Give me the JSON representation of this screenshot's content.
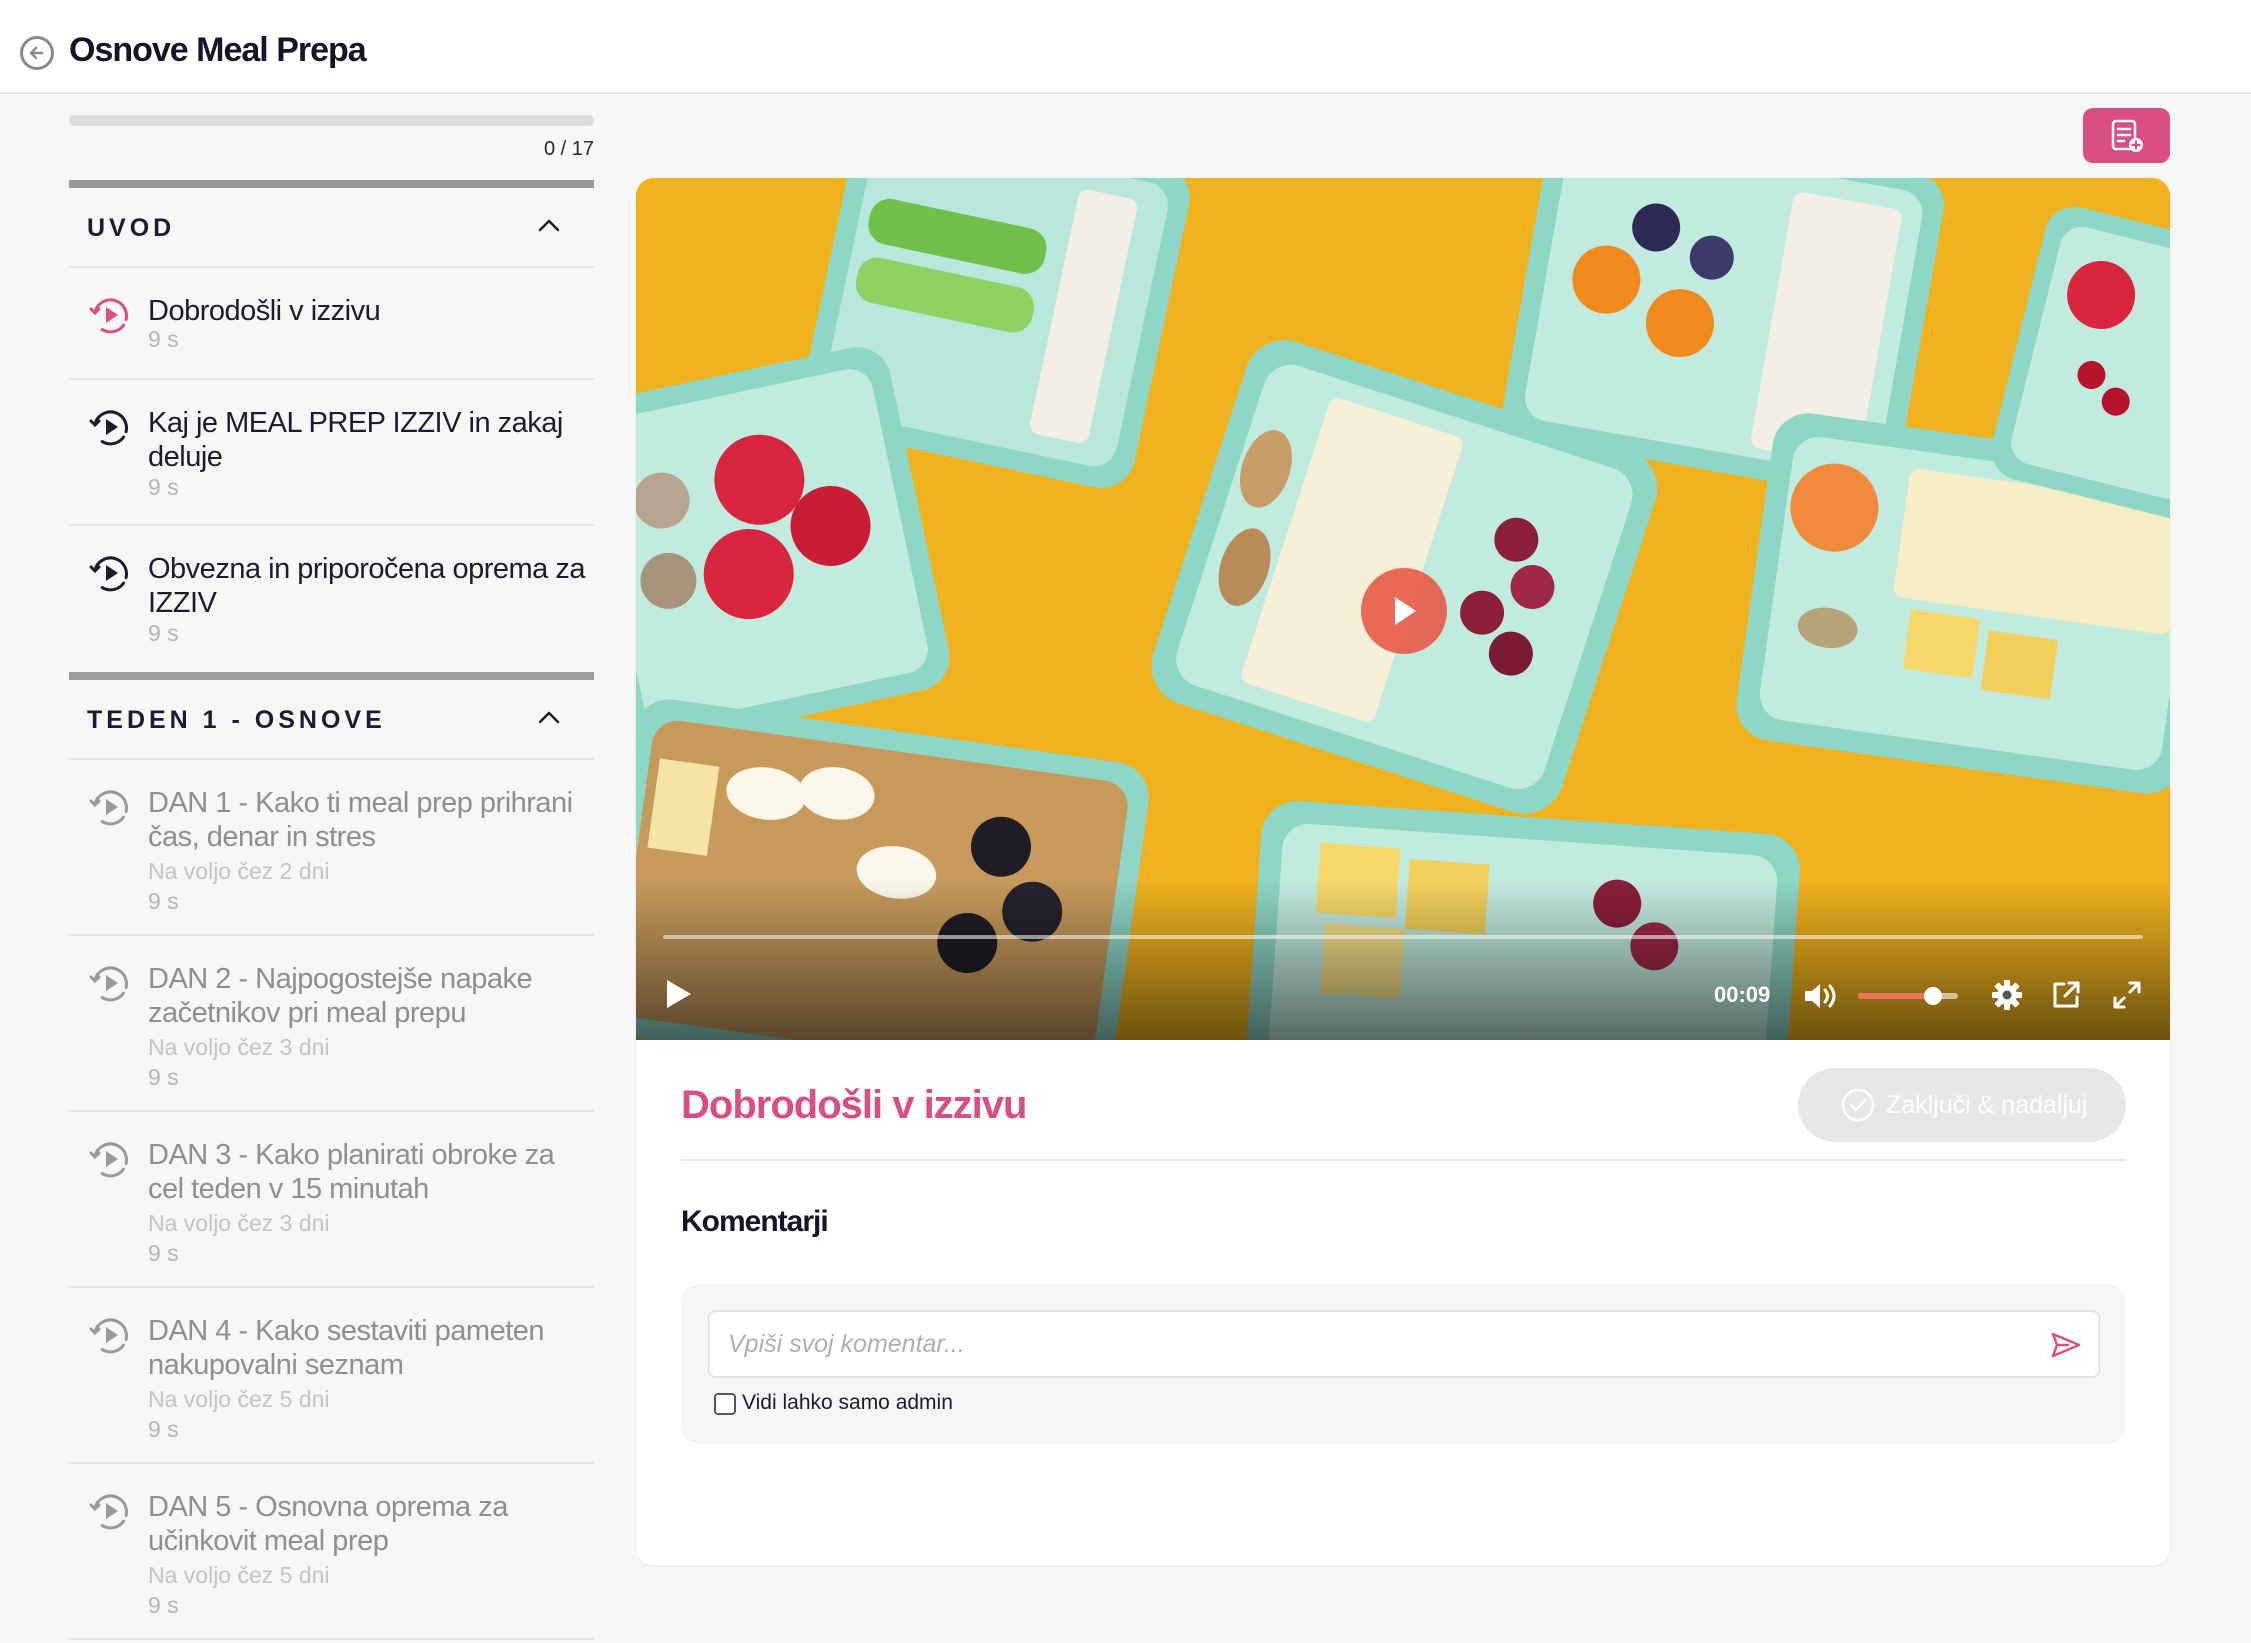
{
  "header": {
    "title": "Osnove Meal Prepa"
  },
  "progress": {
    "completed": 0,
    "total": 17,
    "label": "0 / 17"
  },
  "sections": [
    {
      "title": "UVOD",
      "lessons": [
        {
          "title": "Dobrodošli v izzivu",
          "duration": "9 s",
          "active": true
        },
        {
          "title": "Kaj je MEAL PREP IZZIV in zakaj deluje",
          "duration": "9 s"
        },
        {
          "title": "Obvezna in priporočena oprema za IZZIV",
          "duration": "9 s"
        }
      ]
    },
    {
      "title": "TEDEN 1 - OSNOVE",
      "lessons": [
        {
          "title": "DAN 1 - Kako ti meal prep prihrani čas, denar in stres",
          "availability": "Na voljo čez 2 dni",
          "duration": "9 s"
        },
        {
          "title": "DAN 2 - Najpogostejše napake začetnikov pri meal prepu",
          "availability": "Na voljo čez 3 dni",
          "duration": "9 s"
        },
        {
          "title": "DAN 3 - Kako planirati obroke za cel teden v 15 minutah",
          "availability": "Na voljo čez 3 dni",
          "duration": "9 s"
        },
        {
          "title": "DAN 4 - Kako sestaviti pameten nakupovalni seznam",
          "availability": "Na voljo čez 5 dni",
          "duration": "9 s"
        },
        {
          "title": "DAN 5 - Osnovna oprema za učinkovit meal prep",
          "availability": "Na voljo čez 5 dni",
          "duration": "9 s"
        }
      ]
    }
  ],
  "player": {
    "time": "00:09",
    "volume": 0.75,
    "played": 0.0
  },
  "lesson": {
    "title": "Dobrodošli v izzivu",
    "complete_label": "Zaključi & nadaljuj"
  },
  "comments": {
    "title": "Komentarji",
    "placeholder": "Vpiši svoj komentar...",
    "admin_only_label": "Vidi lahko samo admin",
    "admin_only_checked": false
  },
  "colors": {
    "accent": "#d94f83",
    "video_bg": "#f0b21f",
    "container": "#8ed6c6"
  },
  "icons": [
    "back-arrow-icon",
    "chevron-up-icon",
    "lesson-play-icon",
    "notes-icon",
    "play-icon",
    "volume-icon",
    "settings-icon",
    "popout-icon",
    "fullscreen-icon",
    "check-circle-icon",
    "send-icon"
  ]
}
